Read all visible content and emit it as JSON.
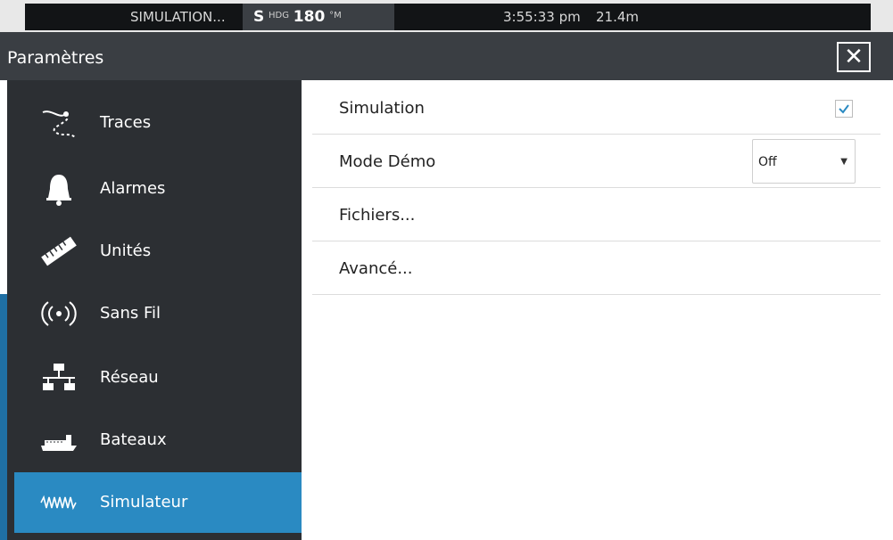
{
  "status": {
    "simulation": "SIMULATION...",
    "hdg_prefix": "S",
    "hdg_label": "HDG",
    "hdg_value": "180",
    "hdg_unit": "°M",
    "time": "3:55:33 pm",
    "depth": "21.4m"
  },
  "header": {
    "title": "Paramètres",
    "close_label": "✕"
  },
  "sidebar": {
    "items": [
      {
        "label": "Traces",
        "icon": "traces-icon"
      },
      {
        "label": "Alarmes",
        "icon": "bell-icon"
      },
      {
        "label": "Unités",
        "icon": "ruler-icon"
      },
      {
        "label": "Sans Fil",
        "icon": "wireless-icon"
      },
      {
        "label": "Réseau",
        "icon": "network-icon"
      },
      {
        "label": "Bateaux",
        "icon": "boat-icon"
      },
      {
        "label": "Simulateur",
        "icon": "waveform-icon"
      }
    ],
    "selected": "Simulateur"
  },
  "main": {
    "simulation_label": "Simulation",
    "simulation_checked": true,
    "demo_label": "Mode Démo",
    "demo_value": "Off",
    "files_label": "Fichiers...",
    "advanced_label": "Avancé..."
  },
  "colors": {
    "accent": "#2a8ac2",
    "sidebar_bg": "#2c2f33",
    "titlebar_bg": "#3a3e43"
  }
}
